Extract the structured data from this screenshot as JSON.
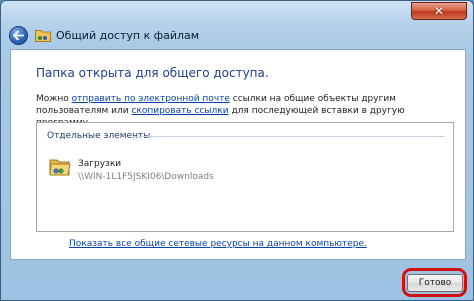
{
  "window": {
    "title": "Общий доступ к файлам",
    "close_symbol": "✕"
  },
  "content": {
    "heading": "Папка открыта для общего доступа.",
    "desc_prefix": "Можно ",
    "email_link": "отправить по электронной почте",
    "desc_middle": " ссылки на общие объекты другим пользователям или ",
    "copy_link": "скопировать ссылки",
    "desc_suffix": " для последующей вставки в другую программу."
  },
  "shared_items": {
    "group_header": "Отдельные элементы",
    "items": [
      {
        "name": "Загрузки",
        "path": "\\\\WIN-1L1F5JSKI06\\Downloads",
        "icon": "folder-icon"
      }
    ]
  },
  "show_all_link": "Показать все общие сетевые ресурсы на данном компьютере.",
  "footer": {
    "done_label": "Готово"
  },
  "colors": {
    "accent": "#1f3f8c",
    "link": "#0645ad",
    "highlight": "#d10f0f"
  }
}
